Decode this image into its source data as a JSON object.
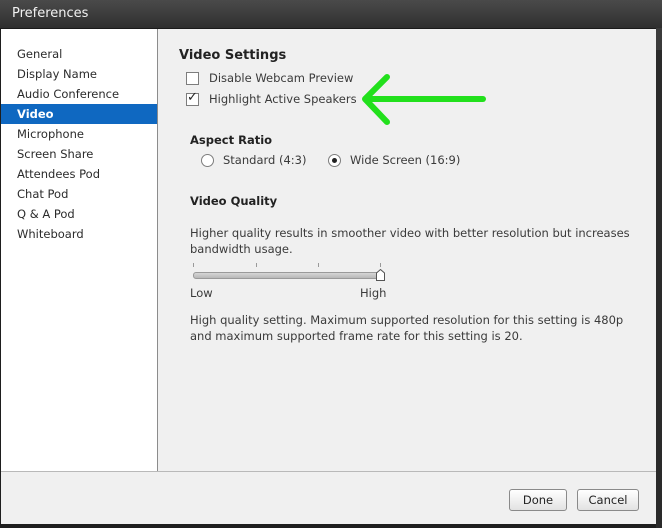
{
  "window": {
    "title": "Preferences"
  },
  "sidebar": {
    "items": [
      {
        "label": "General"
      },
      {
        "label": "Display Name"
      },
      {
        "label": "Audio Conference"
      },
      {
        "label": "Video",
        "selected": true
      },
      {
        "label": "Microphone"
      },
      {
        "label": "Screen Share"
      },
      {
        "label": "Attendees Pod"
      },
      {
        "label": "Chat Pod"
      },
      {
        "label": "Q & A Pod"
      },
      {
        "label": "Whiteboard"
      }
    ]
  },
  "video": {
    "heading": "Video Settings",
    "disable_webcam_preview": {
      "label": "Disable Webcam Preview",
      "checked": false
    },
    "highlight_active_speakers": {
      "label": "Highlight Active Speakers",
      "checked": true
    },
    "aspect_ratio": {
      "heading": "Aspect Ratio",
      "options": [
        {
          "label": "Standard (4:3)",
          "selected": false
        },
        {
          "label": "Wide Screen (16:9)",
          "selected": true
        }
      ]
    },
    "quality": {
      "heading": "Video Quality",
      "description": "Higher quality results in smoother video with better resolution but increases bandwidth usage.",
      "low_label": "Low",
      "high_label": "High",
      "level": 1.0,
      "setting_info": "High quality setting. Maximum supported resolution for this setting is 480p and maximum supported frame rate for this setting is 20."
    }
  },
  "footer": {
    "done_label": "Done",
    "cancel_label": "Cancel"
  },
  "colors": {
    "selection": "#0f68c1",
    "annotation_arrow": "#22e01c"
  }
}
